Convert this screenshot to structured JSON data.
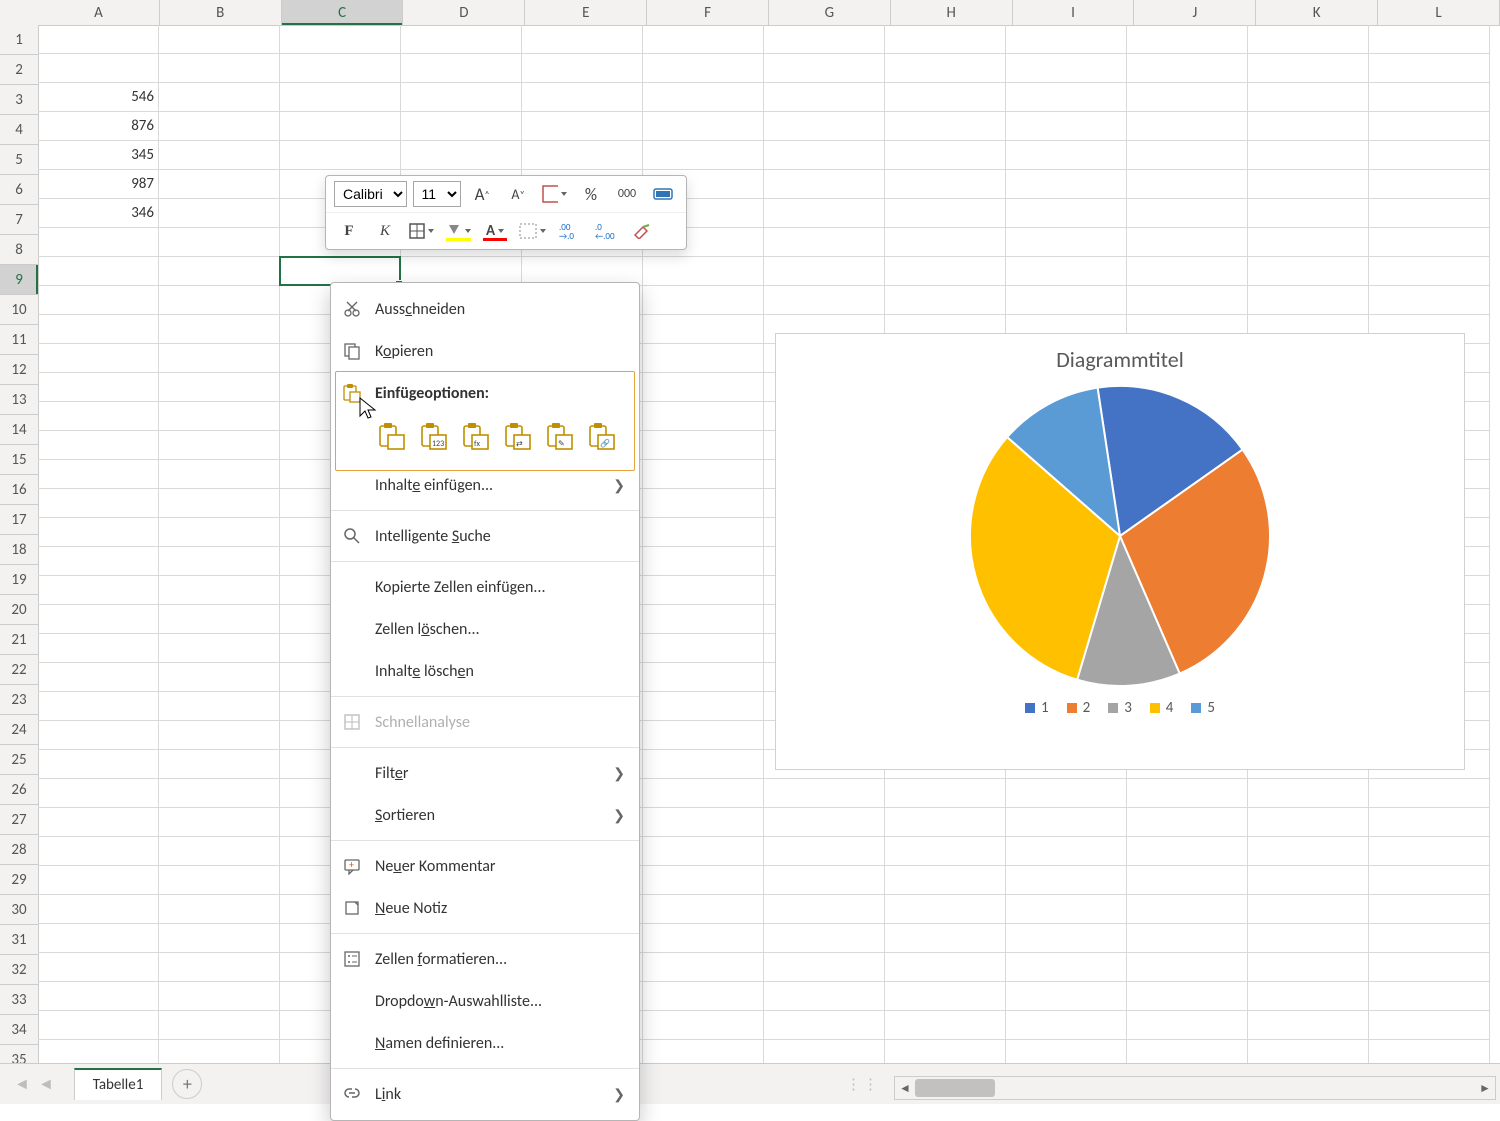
{
  "columns": [
    "A",
    "B",
    "C",
    "D",
    "E",
    "F",
    "G",
    "H",
    "I",
    "J",
    "K",
    "L"
  ],
  "row_count": 36,
  "active": {
    "col_index": 2,
    "row_index": 8,
    "col_label": "C",
    "row_label": "9"
  },
  "cells": {
    "A3": "546",
    "A4": "876",
    "A5": "345",
    "A6": "987",
    "A7": "346"
  },
  "mini_toolbar": {
    "font_name": "Calibri",
    "font_size": "11",
    "percent": "%",
    "thousands": "000"
  },
  "context_menu": {
    "cut": "Ausschneiden",
    "copy": "Kopieren",
    "paste_header": "Einfügeoptionen:",
    "paste_options": [
      "paste",
      "paste-values",
      "paste-formulas",
      "paste-transpose",
      "paste-formatting",
      "paste-link"
    ],
    "paste_special": "Inhalte einfügen...",
    "smart_lookup": "Intelligente Suche",
    "insert_copied": "Kopierte Zellen einfügen...",
    "delete_cells": "Zellen löschen...",
    "clear_contents": "Inhalte löschen",
    "quick_analysis": "Schnellanalyse",
    "filter": "Filter",
    "sort": "Sortieren",
    "new_comment": "Neuer Kommentar",
    "new_note": "Neue Notiz",
    "format_cells": "Zellen formatieren...",
    "dropdown_list": "Dropdown-Auswahlliste...",
    "define_name": "Namen definieren...",
    "link": "Link"
  },
  "sheet_tab": "Tabelle1",
  "chart_data": {
    "type": "pie",
    "title": "Diagrammtitel",
    "categories": [
      "1",
      "2",
      "3",
      "4",
      "5"
    ],
    "values": [
      546,
      876,
      345,
      987,
      346
    ],
    "colors": [
      "#4472C4",
      "#ED7D31",
      "#A5A5A5",
      "#FFC000",
      "#5B9BD5"
    ]
  }
}
